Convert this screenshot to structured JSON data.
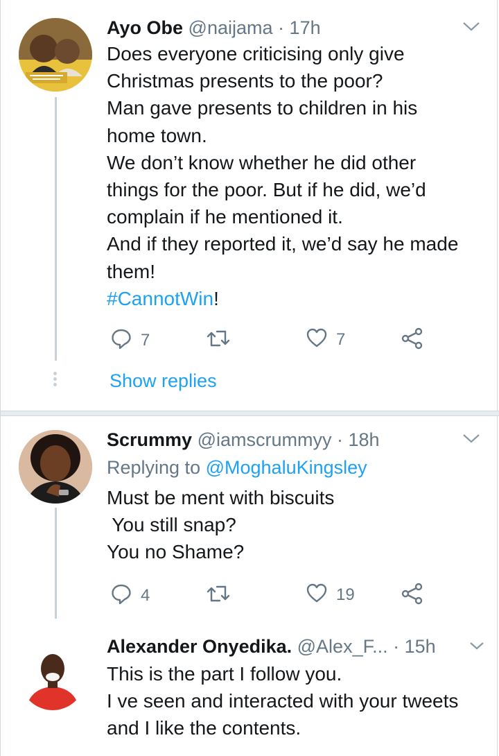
{
  "tweets": [
    {
      "name": "Ayo Obe",
      "handle": "@naijama",
      "sep": "·",
      "time": "17h",
      "lines": [
        "Does everyone criticising only give",
        "Christmas presents to the poor?",
        "Man gave presents to children in his",
        "home town.",
        "We don’t know whether he did other",
        "things for the poor. But if he did, we’d",
        "complain if he mentioned it.",
        "And if they reported it, we’d say he made",
        "them!"
      ],
      "hashtag": "#CannotWin",
      "hashtag_suffix": "!",
      "reply_count": "7",
      "retweet_count": "",
      "like_count": "7",
      "show_replies": "Show replies"
    },
    {
      "name": "Scrummy",
      "handle": "@iamscrummyy",
      "sep": "·",
      "time": "18h",
      "replying_prefix": "Replying to",
      "replying_to": "@MoghaluKingsley",
      "lines": [
        "Must be ment with biscuits",
        " You still snap?",
        "You no Shame?"
      ],
      "reply_count": "4",
      "retweet_count": "",
      "like_count": "19"
    },
    {
      "name": "Alexander Onyedika.",
      "handle": "@Alex_F...",
      "sep": "·",
      "time": "15h",
      "lines": [
        "This is the part I follow you.",
        "I ve seen and interacted with your tweets",
        "and I like the contents."
      ]
    }
  ],
  "colors": {
    "accent": "#1da1f2",
    "meta": "#657786",
    "text": "#14171a",
    "divider": "#e6ecf0"
  },
  "icons": [
    "reply-icon",
    "retweet-icon",
    "like-icon",
    "share-icon",
    "chevron-down-icon"
  ]
}
